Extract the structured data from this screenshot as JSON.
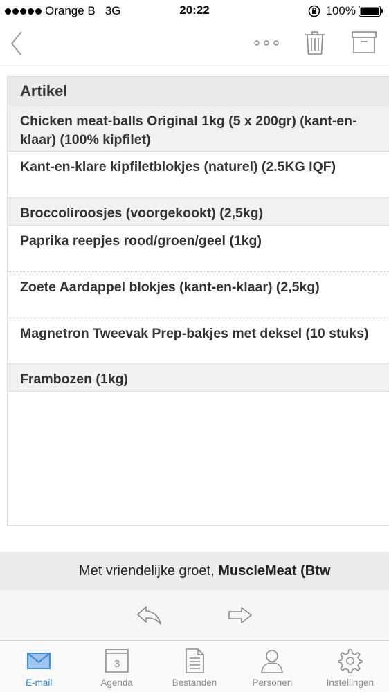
{
  "status_bar": {
    "carrier": "Orange B",
    "network": "3G",
    "time": "20:22",
    "battery": "100%"
  },
  "nav": {
    "back_icon": "chevron-left-icon",
    "more_icon": "more-icon",
    "trash_icon": "trash-icon",
    "archive_icon": "archive-icon"
  },
  "table": {
    "header": "Artikel",
    "rows": [
      {
        "text": "Chicken meat-balls Original 1kg (5 x 200gr) (kant-en-klaar) (100% kipfilet)"
      },
      {
        "text": "Kant-en-klare kipfiletblokjes (naturel) (2.5KG IQF)"
      },
      {
        "text": "Broccoliroosjes (voorgekookt) (2,5kg)"
      },
      {
        "text": "Paprika reepjes rood/groen/geel (1kg)"
      },
      {
        "text": "Zoete Aardappel blokjes (kant-en-klaar) (2,5kg)"
      },
      {
        "text": "Magnetron Tweevak Prep-bakjes met deksel (10 stuks)"
      },
      {
        "text": "Frambozen (1kg)"
      }
    ]
  },
  "signature": {
    "prefix": "Met vriendelijke groet, ",
    "company": "MuscleMeat (Btw"
  },
  "tabs": [
    {
      "label": "E-mail",
      "icon": "mail-icon",
      "active": true
    },
    {
      "label": "Agenda",
      "icon": "calendar-icon",
      "badge": "3"
    },
    {
      "label": "Bestanden",
      "icon": "document-icon"
    },
    {
      "label": "Personen",
      "icon": "person-icon"
    },
    {
      "label": "Instellingen",
      "icon": "gear-icon"
    }
  ],
  "colors": {
    "accent": "#2f86d9",
    "icon_gray": "#9a9a9a"
  }
}
